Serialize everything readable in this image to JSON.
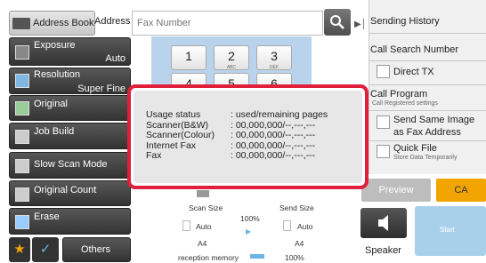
{
  "header": {
    "address_book_label": "Address Book",
    "address_label": "Address",
    "fax_placeholder": "Fax Number"
  },
  "left_menu": {
    "exposure_label": "Exposure",
    "exposure_value": "Auto",
    "resolution_label": "Resolution",
    "resolution_value": "Super Fine",
    "original_label": "Original",
    "job_build_label": "Job Build",
    "slow_scan_label": "Slow Scan Mode",
    "original_count_label": "Original Count",
    "erase_label": "Erase",
    "others_label": "Others"
  },
  "keypad": {
    "keys": [
      {
        "num": "1",
        "letters": ""
      },
      {
        "num": "2",
        "letters": "ABC"
      },
      {
        "num": "3",
        "letters": "DEF"
      },
      {
        "num": "4",
        "letters": ""
      },
      {
        "num": "5",
        "letters": ""
      },
      {
        "num": "6",
        "letters": ""
      }
    ]
  },
  "right_panel": {
    "sending_history": "Sending History",
    "call_search_number": "Call Search Number",
    "direct_tx": "Direct TX",
    "call_program": "Call Program",
    "call_program_sub": "Call Registered settings",
    "send_same_image": "Send Same Image",
    "send_same_image_2": "as Fax Address",
    "quick_file": "Quick File",
    "quick_file_sub": "Store Data Temporarily",
    "preview_label": "Preview",
    "ca_label": "CA",
    "speaker_label": "Speaker",
    "start_label": "Start"
  },
  "popup": {
    "rows": [
      {
        "key": "Usage status",
        "value": ": used/remaining pages"
      },
      {
        "key": "Scanner(B&W)",
        "value": ": 00,000,000/--,---,---"
      },
      {
        "key": "Scanner(Colour)",
        "value": ": 00,000,000/--,---,---"
      },
      {
        "key": "Internet Fax",
        "value": ": 00,000,000/--,---,---"
      },
      {
        "key": "Fax",
        "value": ": 00,000,000/--,---,---"
      }
    ]
  },
  "bottom": {
    "scan_size_label": "Scan Size",
    "send_size_label": "Send Size",
    "scan_size_value": "Auto",
    "send_size_value": "Auto",
    "ratio": "100%",
    "scan_paper": "A4",
    "send_paper": "A4",
    "memory_label": "reception memory",
    "memory_value": "100%"
  },
  "colors": {
    "popup_border": "#e0203a",
    "ca_button": "#f2a400",
    "start_button": "#a9d0ea"
  }
}
